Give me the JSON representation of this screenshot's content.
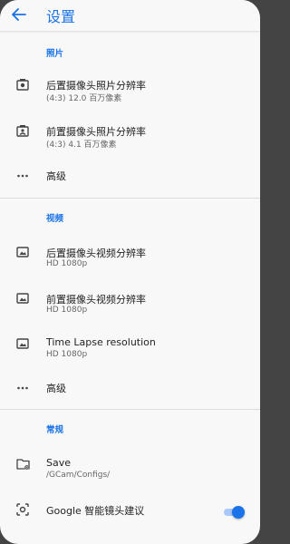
{
  "app": {
    "title": "设置"
  },
  "sections": {
    "photo": {
      "header": "照片",
      "rear_res": {
        "title": "后置摄像头照片分辨率",
        "value": "(4:3) 12.0 百万像素"
      },
      "front_res": {
        "title": "前置摄像头照片分辨率",
        "value": "(4:3) 4.1 百万像素"
      },
      "advanced": {
        "title": "高级"
      }
    },
    "video": {
      "header": "视频",
      "rear_res": {
        "title": "后置摄像头视频分辨率",
        "value": "HD 1080p"
      },
      "front_res": {
        "title": "前置摄像头视频分辨率",
        "value": "HD 1080p"
      },
      "timelapse": {
        "title": "Time Lapse resolution",
        "value": "HD 1080p"
      },
      "advanced": {
        "title": "高级"
      }
    },
    "general": {
      "header": "常规",
      "save": {
        "title": "Save",
        "value": "/GCam/Configs/"
      },
      "lens": {
        "title": "Google 智能镜头建议",
        "enabled": true
      }
    }
  },
  "icons": {
    "back": "arrow-back-icon",
    "photo": "camera-icon",
    "front": "front-camera-icon",
    "more": "more-horiz-icon",
    "video": "videocam-icon",
    "folder": "folder-settings-icon",
    "lens": "lens-icon"
  },
  "colors": {
    "accent": "#1a73e8",
    "toggle_track": "#a8c7fa",
    "background": "#f8f8f8"
  }
}
